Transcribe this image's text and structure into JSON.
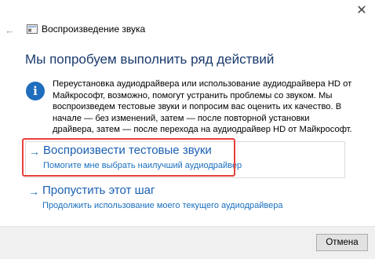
{
  "window": {
    "close_glyph": "✕",
    "back_glyph": "←",
    "title": "Воспроизведение звука"
  },
  "main": {
    "heading": "Мы попробуем выполнить ряд действий",
    "info_glyph": "i",
    "info_text": "Переустановка аудиодрайвера или использование аудиодрайвера HD от Майкрософт, возможно, помогут устранить проблемы со звуком. Мы воспроизведем тестовые звуки и попросим вас оценить их качество. В начале — без изменений, затем — после повторной установки драйвера, затем — после перехода на аудиодрайвер HD от Майкрософт.",
    "options": [
      {
        "arrow": "→",
        "title": "Воспроизвести тестовые звуки",
        "description": "Помогите мне выбрать наилучший аудиодрайвер"
      },
      {
        "arrow": "→",
        "title": "Пропустить этот шаг",
        "description": "Продолжить использование моего текущего аудиодрайвера"
      }
    ]
  },
  "footer": {
    "cancel_label": "Отмена"
  },
  "colors": {
    "link": "#1a5fb4",
    "heading": "#1a3a6d",
    "info_icon": "#1f6dbd",
    "highlight": "#e8403a"
  },
  "icons": [
    "close-icon",
    "back-arrow-icon",
    "audio-troubleshooter-icon",
    "info-icon",
    "arrow-right-icon"
  ]
}
